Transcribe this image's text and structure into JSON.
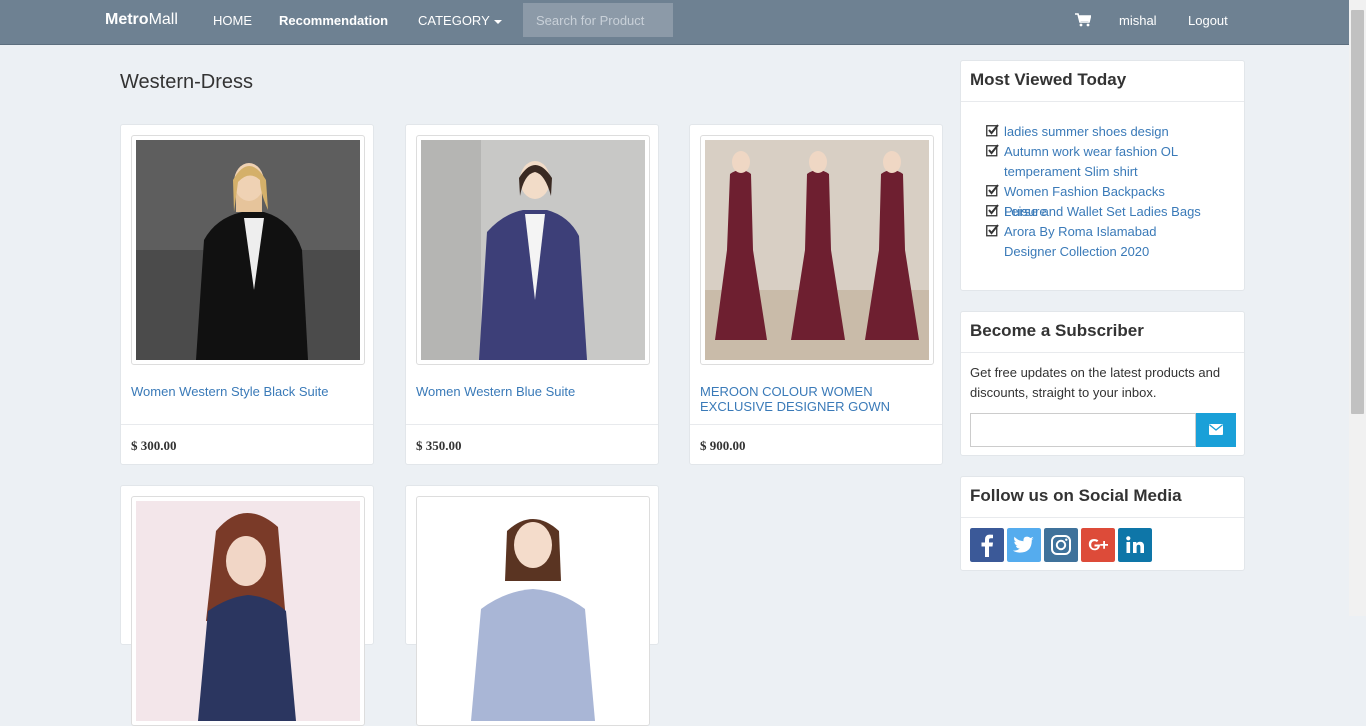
{
  "navbar": {
    "brand_bold": "Metro",
    "brand_rest": "Mall",
    "links": [
      "HOME",
      "Recommendation",
      "CATEGORY"
    ],
    "search_placeholder": "Search for Product",
    "user": "mishal",
    "logout": "Logout"
  },
  "page": {
    "heading": "Western-Dress"
  },
  "products": [
    {
      "title": "Women Western Style Black Suite",
      "price": "$ 300.00"
    },
    {
      "title": "Women Western Blue Suite",
      "price": "$ 350.00"
    },
    {
      "title": "MEROON COLOUR WOMEN EXCLUSIVE DESIGNER GOWN",
      "price": "$ 900.00"
    },
    {
      "title": "",
      "price": ""
    },
    {
      "title": "",
      "price": ""
    }
  ],
  "most_viewed": {
    "title": "Most Viewed Today",
    "items": [
      "ladies summer shoes design",
      "Autumn work wear fashion OL temperament Slim shirt",
      "Women Fashion Backpacks Leisure",
      "Purse and Wallet Set Ladies Bags",
      "Arora By Roma Islamabad Designer Collection 2020"
    ]
  },
  "subscriber": {
    "title": "Become a Subscriber",
    "text": "Get free updates on the latest products and discounts, straight to your inbox."
  },
  "social": {
    "title": "Follow us on Social Media",
    "icons": [
      "facebook-icon",
      "twitter-icon",
      "instagram-icon",
      "google-plus-icon",
      "linkedin-icon"
    ]
  },
  "colors": {
    "navbar": "#6e8192",
    "link": "#3a7ab8",
    "subscribe_button": "#1aa0d8",
    "facebook": "#3b5998",
    "twitter": "#55acee",
    "instagram": "#3f729b",
    "google_plus": "#dd4b39",
    "linkedin": "#0e76a8"
  }
}
